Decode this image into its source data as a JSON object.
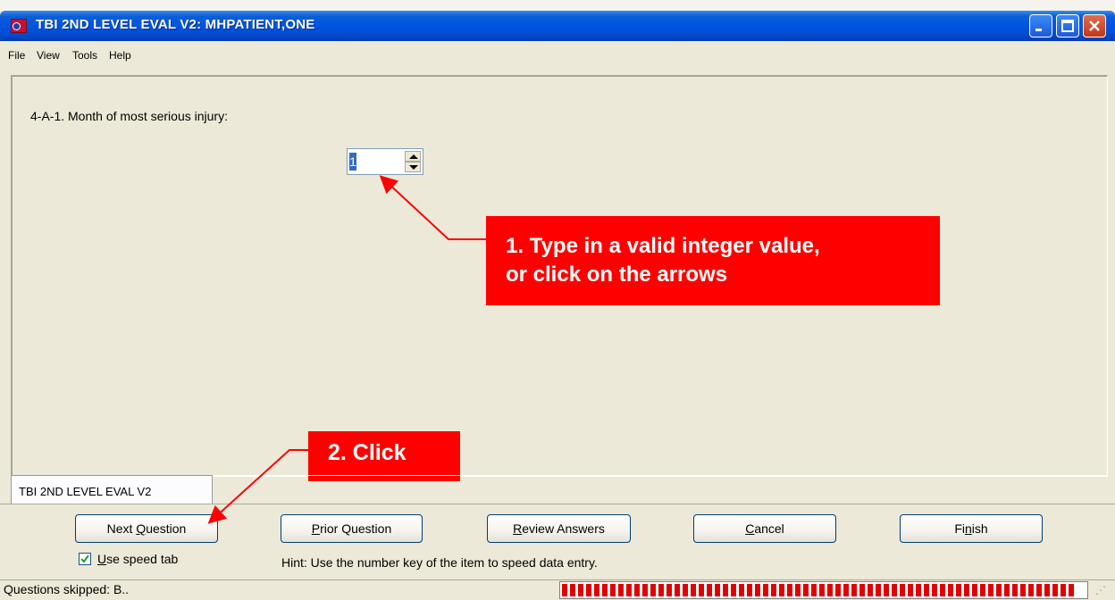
{
  "window": {
    "title": "TBI 2ND LEVEL EVAL V2: MHPATIENT,ONE",
    "controls": [
      "minimize-icon",
      "maximize-icon",
      "close-icon"
    ]
  },
  "menu": {
    "items": [
      "File",
      "View",
      "Tools",
      "Help"
    ]
  },
  "question": {
    "text": "4-A-1. Month of most serious injury:",
    "value": "1"
  },
  "annotations": {
    "callout1": [
      "1. Type in a valid integer value,",
      "or click on the arrows"
    ],
    "callout2": "2. Click",
    "color": "#ff0000"
  },
  "tab": {
    "label": "TBI 2ND LEVEL EVAL V2"
  },
  "buttons": {
    "next": {
      "pre": "Next ",
      "key": "Q",
      "post": "uestion"
    },
    "prior": {
      "pre": "",
      "key": "P",
      "post": "rior Question"
    },
    "review": {
      "pre": "",
      "key": "R",
      "post": "eview Answers"
    },
    "cancel": {
      "pre": "",
      "key": "C",
      "post": "ancel"
    },
    "finish": {
      "pre": "Fi",
      "key": "n",
      "post": "ish"
    }
  },
  "speed_tab": {
    "pre": "",
    "key": "U",
    "post": "se speed tab",
    "checked": true
  },
  "hint": "Hint: Use the number key of the item to speed data entry.",
  "status": {
    "text": "Questions skipped: B..",
    "progress_fraction": 0.98,
    "progress_color": "#e00000"
  }
}
